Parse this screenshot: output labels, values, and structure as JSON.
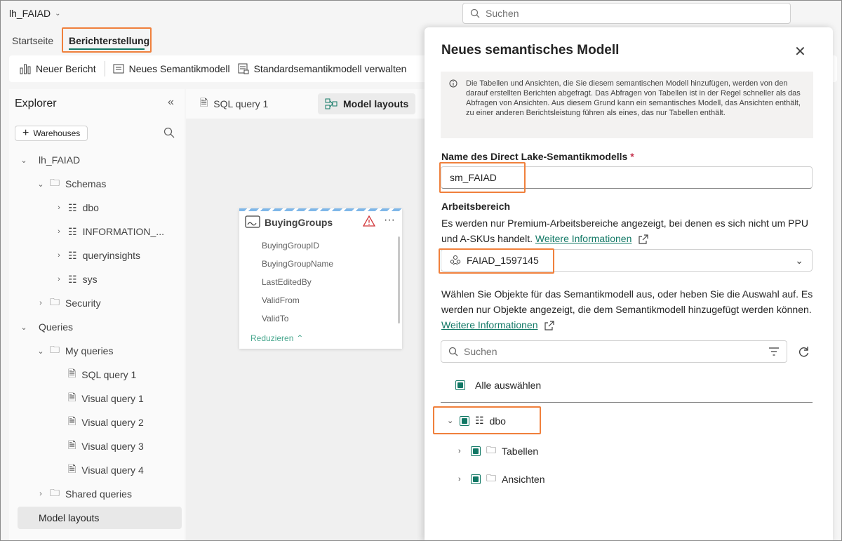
{
  "workspace": {
    "name": "lh_FAIAD"
  },
  "topsearch": {
    "placeholder": "Suchen"
  },
  "ribbon": {
    "tabs": [
      {
        "label": "Startseite"
      },
      {
        "label": "Berichterstellung"
      }
    ],
    "toolbar": {
      "new_report": "Neuer Bericht",
      "new_semantic_model": "Neues Semantikmodell",
      "manage_default": "Standardsemantikmodell verwalten"
    }
  },
  "explorer": {
    "title": "Explorer",
    "warehouses_button": "Warehouses",
    "tree": {
      "root": "lh_FAIAD",
      "schemas": "Schemas",
      "dbo": "dbo",
      "information": "INFORMATION_...",
      "queryinsights": "queryinsights",
      "sys": "sys",
      "security": "Security",
      "queries": "Queries",
      "my_queries": "My queries",
      "sql_query_1": "SQL query 1",
      "visual_query_1": "Visual query 1",
      "visual_query_2": "Visual query 2",
      "visual_query_3": "Visual query 3",
      "visual_query_4": "Visual query 4",
      "shared_queries": "Shared queries",
      "model_layouts": "Model layouts"
    }
  },
  "canvas": {
    "tabs": [
      {
        "label": "SQL query 1"
      },
      {
        "label": "Model layouts"
      }
    ],
    "table_card": {
      "title": "BuyingGroups",
      "columns": [
        "BuyingGroupID",
        "BuyingGroupName",
        "LastEditedBy",
        "ValidFrom",
        "ValidTo"
      ],
      "reduce": "Reduzieren"
    }
  },
  "dialog": {
    "title": "Neues semantisches Modell",
    "info": "Die Tabellen und Ansichten, die Sie diesem semantischen Modell hinzufügen, werden von den darauf erstellten Berichten abgefragt. Das Abfragen von Tabellen ist in der Regel schneller als das Abfragen von Ansichten. Aus diesem Grund kann ein semantisches Modell, das Ansichten enthält, zu einer anderen Berichtsleistung führen als eines, das nur Tabellen enthält.",
    "name_label": "Name des Direct Lake-Semantikmodells",
    "name_required": "*",
    "name_value": "sm_FAIAD",
    "workspace_label": "Arbeitsbereich",
    "workspace_desc": "Es werden nur Premium-Arbeitsbereiche angezeigt, bei denen es sich nicht um PPU und A-SKUs handelt.",
    "more_info": "Weitere Informationen",
    "workspace_value": "FAIAD_1597145",
    "objects_desc": "Wählen Sie Objekte für das Semantikmodell aus, oder heben Sie die Auswahl auf. Es werden nur Objekte angezeigt, die dem Semantikmodell hinzugefügt werden können.",
    "search_placeholder": "Suchen",
    "select_all": "Alle auswählen",
    "tree": {
      "dbo": "dbo",
      "tables": "Tabellen",
      "views": "Ansichten"
    }
  }
}
